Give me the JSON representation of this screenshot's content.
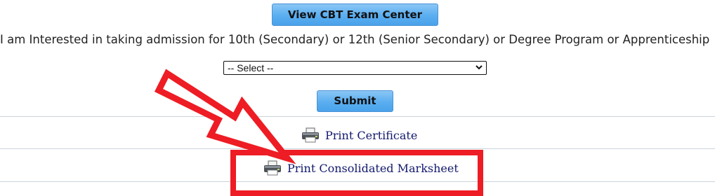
{
  "buttons": {
    "view_cbt_label": "View CBT Exam Center",
    "submit_label": "Submit"
  },
  "question": {
    "text": "I am Interested in taking admission for 10th (Secondary) or 12th (Senior Secondary) or Degree Program or Apprenticeship"
  },
  "program_select": {
    "selected": "-- Select --"
  },
  "links": {
    "print_certificate": "Print Certificate",
    "print_consolidated_marksheet": "Print Consolidated Marksheet"
  },
  "colors": {
    "button_blue": "#5aaef0",
    "link_text": "#13196e",
    "highlight_red": "#ee1c24"
  },
  "icons": {
    "printer": "printer-icon",
    "dropdown": "chevron-down-icon",
    "annotation": "red-arrow"
  }
}
